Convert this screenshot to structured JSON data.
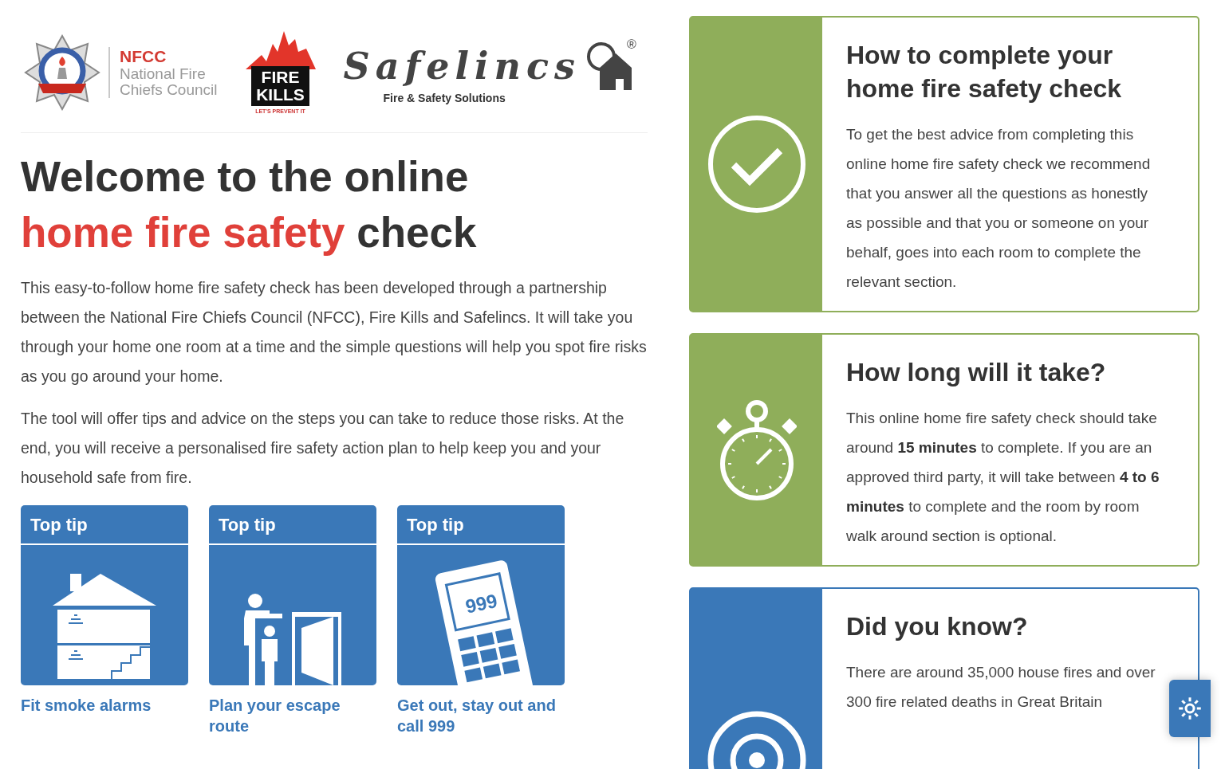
{
  "logos": {
    "nfcc": {
      "acronym": "NFCC",
      "name_lines": [
        "National Fire",
        "Chiefs Council"
      ]
    },
    "fire_kills": {
      "line1": "FIRE",
      "line2": "KILLS",
      "tagline": "LET'S PREVENT IT"
    },
    "safelincs": {
      "wordmark": "Safelincs",
      "registered": "®",
      "tagline": "Fire & Safety Solutions"
    }
  },
  "heading": {
    "line1": "Welcome to the online",
    "highlight": "home fire safety",
    "rest": "check"
  },
  "intro": [
    "This easy-to-follow home fire safety check has been developed through a partnership between the National Fire Chiefs Council (NFCC), Fire Kills and Safelincs. It will take you through your home one room at a time and the simple questions will help you spot fire risks as you go around your home.",
    "The tool will offer tips and advice on the steps you can take to reduce those risks. At the end, you will receive a personalised fire safety action plan to help keep you and your household safe from fire."
  ],
  "tips": [
    {
      "label": "Top tip",
      "caption": "Fit smoke alarms",
      "kind": "smoke-alarm"
    },
    {
      "label": "Top tip",
      "caption": "Plan your escape route",
      "kind": "escape"
    },
    {
      "label": "Top tip",
      "caption": "Get out, stay out and call 999",
      "kind": "phone",
      "screen": "999"
    }
  ],
  "cards": [
    {
      "kind": "check",
      "color": "#8fae5a",
      "title": "How to complete your home fire safety check",
      "body": [
        "To get the best advice from completing this online home fire safety check we recommend that you answer all the questions as honestly as possible and that you or someone on your behalf, goes into each room to complete the relevant section."
      ]
    },
    {
      "kind": "stopwatch",
      "color": "#8fae5a",
      "title": "How long will it take?",
      "body": [
        "This online home fire safety check should take around **15 minutes** to complete. If you are an approved third party, it will take between **4 to 6 minutes** to complete and the room by room walk around section is optional."
      ]
    },
    {
      "kind": "target",
      "color": "#3a78b8",
      "title": "Did you know?",
      "body": [
        "There are around 35,000 house fires and over 300 fire related deaths in Great Britain"
      ]
    }
  ]
}
